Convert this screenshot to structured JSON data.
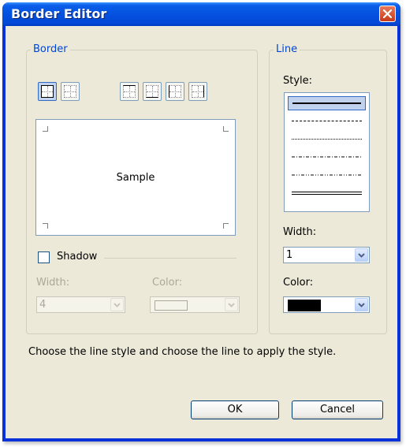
{
  "window": {
    "title": "Border Editor"
  },
  "border_group": {
    "legend": "Border",
    "toolbar": [
      {
        "id": "all-lines",
        "active": true
      },
      {
        "id": "no-lines",
        "active": false
      },
      {
        "id": "top-line",
        "active": false
      },
      {
        "id": "bottom-line",
        "active": false
      },
      {
        "id": "left-line",
        "active": false
      },
      {
        "id": "right-line",
        "active": false
      }
    ],
    "sample_text": "Sample",
    "shadow": {
      "label": "Shadow",
      "checked": false,
      "width_label": "Width:",
      "width_value": "4",
      "color_label": "Color:"
    }
  },
  "line_group": {
    "legend": "Line",
    "style_label": "Style:",
    "styles": [
      "solid",
      "dashed",
      "dotted",
      "dash-dot",
      "dash-dot-dot",
      "double"
    ],
    "selected_style": "solid",
    "width_label": "Width:",
    "width_value": "1",
    "color_label": "Color:",
    "color_value": "#000000"
  },
  "hint_text": "Choose the line style and choose the line to apply the style.",
  "buttons": {
    "ok": "OK",
    "cancel": "Cancel"
  },
  "colors": {
    "title_bar": "#0551e0",
    "dialog_bg": "#ece9d8",
    "group_label": "#0046d5",
    "selection": "#c1d2ee"
  }
}
